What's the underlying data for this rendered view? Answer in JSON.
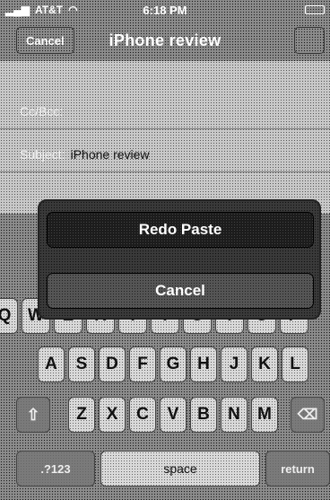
{
  "status_bar": {
    "carrier": "AT&T",
    "time": "6:18 PM"
  },
  "nav": {
    "left_button": "Cancel",
    "title": "iPhone review"
  },
  "compose": {
    "cc_label": "Cc/Bcc:",
    "subject_label": "Subject:",
    "subject_value": "iPhone review"
  },
  "action_sheet": {
    "redo_label": "Redo Paste",
    "cancel_label": "Cancel"
  },
  "keyboard": {
    "row1": [
      "Q",
      "W",
      "E",
      "R",
      "T",
      "Y",
      "U",
      "I",
      "O",
      "P"
    ],
    "row2": [
      "A",
      "S",
      "D",
      "F",
      "G",
      "H",
      "J",
      "K",
      "L"
    ],
    "row3": [
      "Z",
      "X",
      "C",
      "V",
      "B",
      "N",
      "M"
    ],
    "numbers_key": ".?123",
    "space_key": "space",
    "return_key": "return"
  }
}
